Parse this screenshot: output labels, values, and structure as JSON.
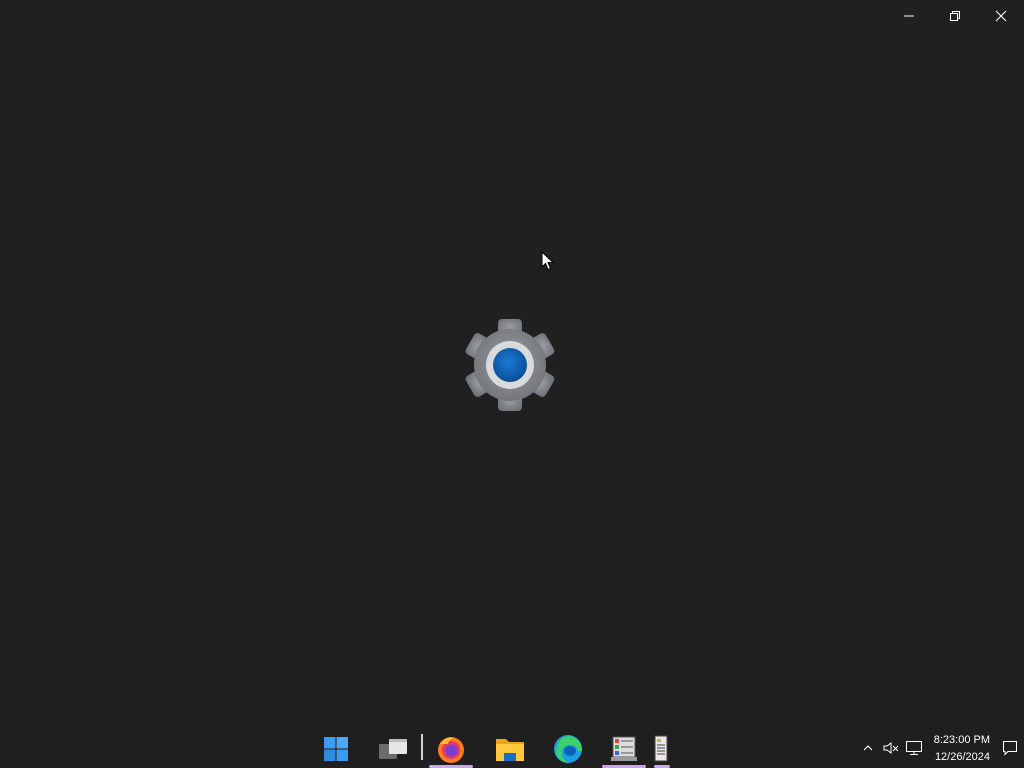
{
  "window": {
    "caption_buttons": [
      {
        "name": "minimize-button",
        "icon": "minimize-icon"
      },
      {
        "name": "restore-button",
        "icon": "restore-icon"
      },
      {
        "name": "close-button",
        "icon": "close-icon"
      }
    ],
    "splash_icon": "settings-gear-icon",
    "colors": {
      "background": "#202020",
      "gear": "#8a8d91",
      "accent": "#0e63b8"
    }
  },
  "taskbar": {
    "apps": [
      {
        "name": "start-button",
        "icon": "windows-logo-icon"
      },
      {
        "name": "task-view-button",
        "icon": "task-view-icon"
      },
      {
        "name": "firefox-button",
        "icon": "firefox-icon",
        "running": true
      },
      {
        "name": "file-explorer-button",
        "icon": "folder-icon"
      },
      {
        "name": "edge-button",
        "icon": "edge-icon"
      },
      {
        "name": "control-panel-button",
        "icon": "control-panel-icon",
        "running": true
      },
      {
        "name": "document-app-button",
        "icon": "document-app-icon",
        "running": true
      }
    ],
    "tray": {
      "icons": [
        "chevron-up-icon",
        "sound-muted-icon",
        "network-icon"
      ],
      "time": "8:23:00 PM",
      "date": "12/26/2024",
      "notification_icon": "notification-icon"
    },
    "colors": {
      "running_indicator": "#c9a7e8"
    }
  }
}
